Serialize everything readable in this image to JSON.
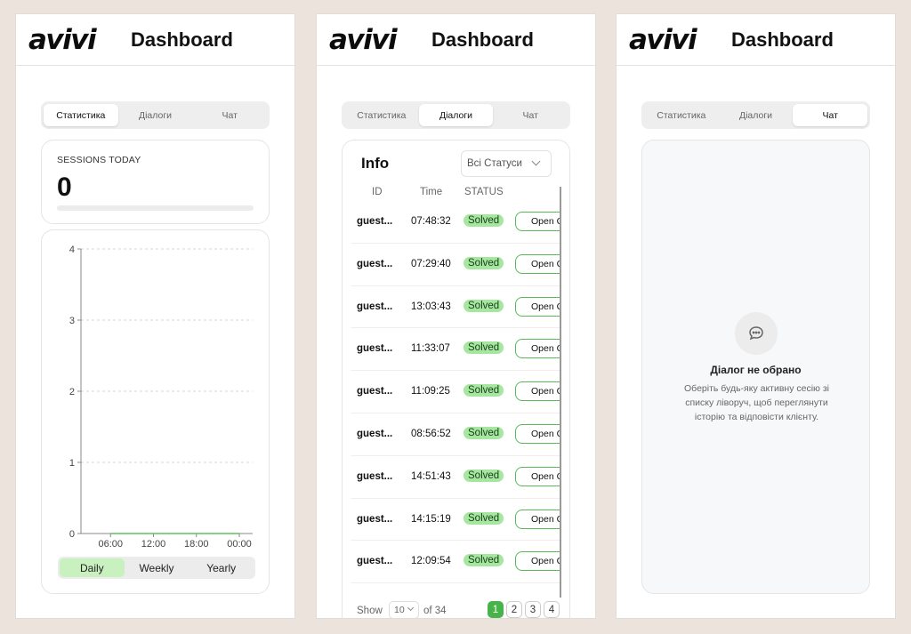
{
  "app": {
    "logo": "avivi",
    "title": "Dashboard"
  },
  "tabs": [
    "Статистика",
    "Діалоги",
    "Чат"
  ],
  "stats": {
    "sessions_label": "SESSIONS TODAY",
    "sessions_value": "0",
    "sessions_progress": 0,
    "range": [
      "Daily",
      "Weekly",
      "Yearly"
    ],
    "range_active": "Daily"
  },
  "chart_data": {
    "type": "line",
    "x": [
      "06:00",
      "12:00",
      "18:00",
      "00:00"
    ],
    "yticks": [
      "0",
      "1",
      "2",
      "3",
      "4"
    ],
    "ylim": [
      0,
      4
    ],
    "values": [
      0,
      0,
      0,
      0
    ],
    "grid": true,
    "title": "",
    "xlabel": "",
    "ylabel": ""
  },
  "dialogs": {
    "title": "Info",
    "status_filter": "Всі Статуси",
    "columns": [
      "ID",
      "Time",
      "STATUS"
    ],
    "rows": [
      {
        "id": "guest...",
        "time": "07:48:32",
        "status": "Solved",
        "action": "Open C"
      },
      {
        "id": "guest...",
        "time": "07:29:40",
        "status": "Solved",
        "action": "Open C"
      },
      {
        "id": "guest...",
        "time": "13:03:43",
        "status": "Solved",
        "action": "Open C"
      },
      {
        "id": "guest...",
        "time": "11:33:07",
        "status": "Solved",
        "action": "Open C"
      },
      {
        "id": "guest...",
        "time": "11:09:25",
        "status": "Solved",
        "action": "Open C"
      },
      {
        "id": "guest...",
        "time": "08:56:52",
        "status": "Solved",
        "action": "Open C"
      },
      {
        "id": "guest...",
        "time": "14:51:43",
        "status": "Solved",
        "action": "Open C"
      },
      {
        "id": "guest...",
        "time": "14:15:19",
        "status": "Solved",
        "action": "Open C"
      },
      {
        "id": "guest...",
        "time": "12:09:54",
        "status": "Solved",
        "action": "Open C"
      }
    ],
    "pager": {
      "show": "Show",
      "per_page": "10",
      "of": "of 34",
      "pages": [
        "1",
        "2",
        "3",
        "4"
      ],
      "current": "1"
    }
  },
  "chat": {
    "icon": "chat-bubble-icon",
    "empty_title": "Діалог не обрано",
    "empty_desc": "Оберіть будь-яку активну сесію зі списку ліворуч, щоб переглянути історію та відповісти клієнту."
  },
  "colors": {
    "accent": "#48b34b",
    "badge": "#a6e7a0",
    "active_range": "#c9f1c0",
    "background": "#ede3dd"
  }
}
